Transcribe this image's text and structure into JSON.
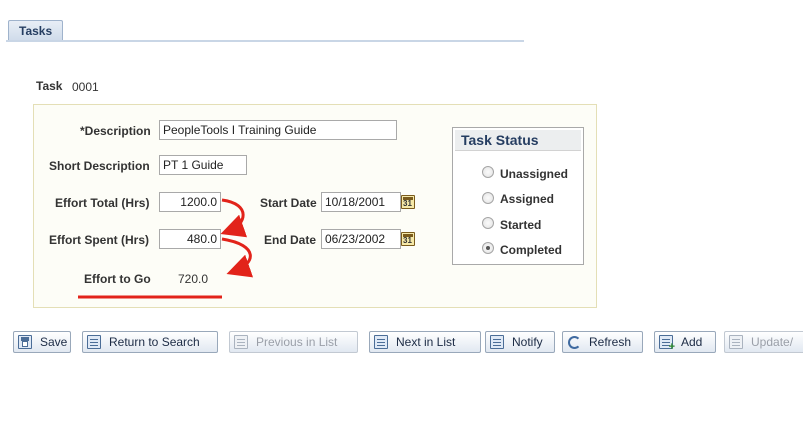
{
  "tabs": [
    {
      "label": "Tasks",
      "active": true
    }
  ],
  "task": {
    "label": "Task",
    "id": "0001"
  },
  "form": {
    "description": {
      "label": "*Description",
      "value": "PeopleTools I Training Guide"
    },
    "short_description": {
      "label": "Short Description",
      "value": "PT 1 Guide"
    },
    "effort_total": {
      "label": "Effort Total (Hrs)",
      "value": "1200.0"
    },
    "effort_spent": {
      "label": "Effort Spent (Hrs)",
      "value": "480.0"
    },
    "effort_to_go": {
      "label": "Effort to Go",
      "value": "720.0"
    },
    "start_date": {
      "label": "Start Date",
      "value": "10/18/2001"
    },
    "end_date": {
      "label": "End Date",
      "value": "06/23/2002"
    }
  },
  "task_status": {
    "title": "Task Status",
    "options": [
      {
        "label": "Unassigned",
        "selected": false
      },
      {
        "label": "Assigned",
        "selected": false
      },
      {
        "label": "Started",
        "selected": false
      },
      {
        "label": "Completed",
        "selected": true
      }
    ]
  },
  "toolbar": {
    "buttons": [
      {
        "label": "Save",
        "icon": "save-icon",
        "enabled": true
      },
      {
        "label": "Return to Search",
        "icon": "return-to-search-icon",
        "enabled": true
      },
      {
        "label": "Previous in List",
        "icon": "previous-in-list-icon",
        "enabled": false
      },
      {
        "label": "Next in List",
        "icon": "next-in-list-icon",
        "enabled": true
      },
      {
        "label": "Notify",
        "icon": "notify-icon",
        "enabled": true
      },
      {
        "label": "Refresh",
        "icon": "refresh-icon",
        "enabled": true
      },
      {
        "label": "Add",
        "icon": "add-icon",
        "enabled": true
      },
      {
        "label": "Update/",
        "icon": "update-display-icon",
        "enabled": false
      }
    ]
  },
  "annotation": {
    "color": "#e2231a"
  },
  "colors": {
    "panel_bg": "#fdfdf7",
    "panel_border": "#e4dfb6",
    "tab_text": "#253d61"
  }
}
